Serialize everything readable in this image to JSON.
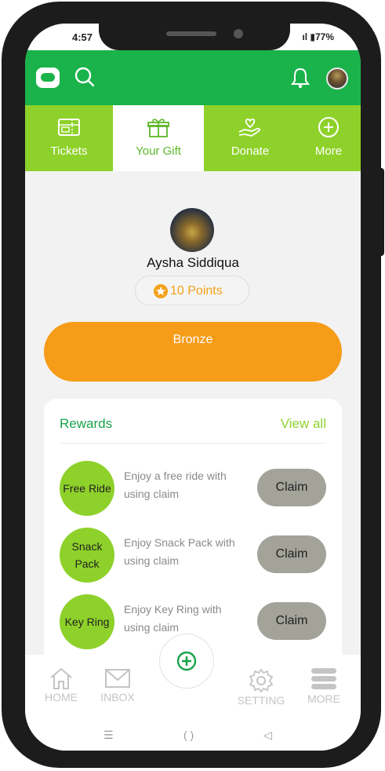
{
  "status": {
    "time": "4:57",
    "right": "ıl ▮77%"
  },
  "tabs": [
    {
      "label": "Tickets",
      "icon": "ticket-icon",
      "active": false
    },
    {
      "label": "Your Gift",
      "icon": "gift-icon",
      "active": true
    },
    {
      "label": "Donate",
      "icon": "donate-hand-heart-icon",
      "active": false
    },
    {
      "label": "More",
      "icon": "plus-circle-icon",
      "active": false
    }
  ],
  "profile": {
    "name": "Aysha Siddiqua",
    "points": "10 Points"
  },
  "tier": {
    "label": "Bronze"
  },
  "rewards": {
    "title": "Rewards",
    "view_all": "View all",
    "items": [
      {
        "title": "Free Ride",
        "description": "Enjoy a free ride with using claim",
        "button": "Claim"
      },
      {
        "title": "Snack Pack",
        "description": "Enjoy Snack Pack with using claim",
        "button": "Claim"
      },
      {
        "title": "Key Ring",
        "description": "Enjoy Key Ring with using claim",
        "button": "Claim"
      }
    ]
  },
  "bottom_nav": {
    "home": "HOME",
    "inbox": "INBOX",
    "setting": "SETTING",
    "more": "MORE"
  },
  "system_nav": {
    "recent": "☰",
    "home": "( )",
    "back": "◁"
  },
  "colors": {
    "primary_green": "#1ab24a",
    "light_green": "#8ed12a",
    "orange": "#f69c18",
    "claim_gray": "#a3a39a"
  }
}
